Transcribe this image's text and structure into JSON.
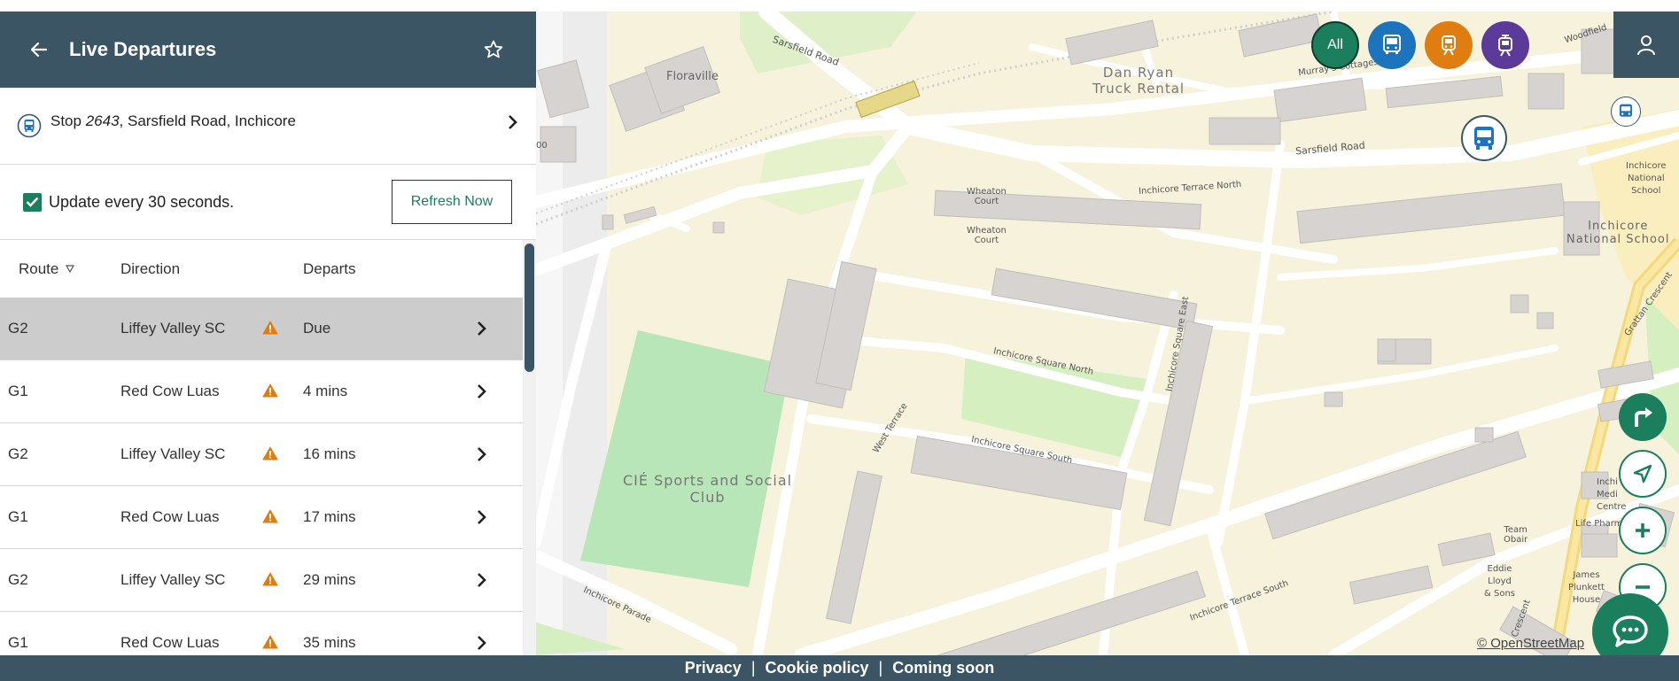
{
  "panel": {
    "title": "Live Departures",
    "stop": {
      "prefix": "Stop ",
      "number": "2643",
      "suffix": ", Sarsfield Road, Inchicore"
    },
    "update_label": "Update every 30 seconds.",
    "update_checked": true,
    "refresh_label": "Refresh Now"
  },
  "table": {
    "headers": {
      "route": "Route",
      "direction": "Direction",
      "departs": "Departs"
    },
    "rows": [
      {
        "route": "G2",
        "direction": "Liffey Valley SC",
        "departs": "Due",
        "selected": true
      },
      {
        "route": "G1",
        "direction": "Red Cow Luas",
        "departs": "4 mins"
      },
      {
        "route": "G2",
        "direction": "Liffey Valley SC",
        "departs": "16 mins"
      },
      {
        "route": "G1",
        "direction": "Red Cow Luas",
        "departs": "17 mins"
      },
      {
        "route": "G2",
        "direction": "Liffey Valley SC",
        "departs": "29 mins"
      },
      {
        "route": "G1",
        "direction": "Red Cow Luas",
        "departs": "35 mins"
      }
    ]
  },
  "map": {
    "mode_all": "All",
    "attribution": "© OpenStreetMap",
    "labels": {
      "floraville": "Floraville",
      "dan_ryan_1": "Dan Ryan",
      "dan_ryan_2": "Truck Rental",
      "murrays": "Murray's Cottages",
      "sarsfield_1": "Sarsfield Road",
      "sarsfield_2": "Sarsfield Road",
      "woodfield": "Woodfield",
      "wheaton_1": "Wheaton",
      "wheaton_2": "Court",
      "inchicore_terrace_north": "Inchicore Terrace North",
      "inchicore_ns_1": "Inchicore",
      "inchicore_ns_2": "National",
      "inchicore_ns_3": "School",
      "inchicore_ns_big_1": "Inchicore",
      "inchicore_ns_big_2": "National School",
      "inchicore_square_north": "Inchicore Square North",
      "inchicore_square_east": "Inchicore Square East",
      "inchicore_square_south": "Inchicore Square South",
      "west_terrace": "West Terrace",
      "cie_1": "CIÉ Sports and Social",
      "cie_2": "Club",
      "inchicore_parade": "Inchicore Parade",
      "inchicore_terrace_south": "Inchicore Terrace South",
      "grattan": "Grattan Crescent",
      "crescent": "Crescent",
      "team_obair_1": "Team",
      "team_obair_2": "Obair",
      "eddie_1": "Eddie",
      "eddie_2": "Lloyd",
      "eddie_3": "& Sons",
      "james_1": "James",
      "james_2": "Plunkett",
      "james_3": "House",
      "life_pharm": "Life Pharm",
      "inchi_med_1": "Inchi",
      "inchi_med_2": "Medi",
      "inchi_med_3": "Centre",
      "oo": "00"
    }
  },
  "footer": {
    "privacy": "Privacy",
    "cookie": "Cookie policy",
    "coming": "Coming soon"
  },
  "colors": {
    "header": "#3c5564",
    "accent": "#1b7f5e",
    "bus": "#1c75bc",
    "rail": "#e07d10",
    "luas": "#5b3a99",
    "warning": "#e07d10"
  }
}
